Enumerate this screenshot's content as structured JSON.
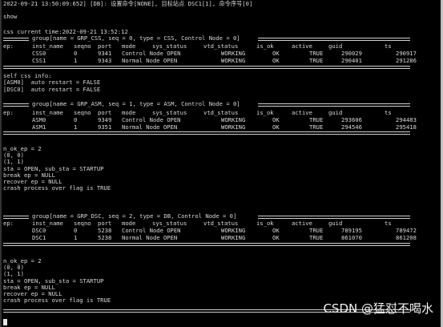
{
  "terminal": {
    "header": "2022-09-21 13:50:09:652] [DB]: 设置命令[NONE], 目标站点 DSC1[1], 命令序号[0]",
    "show": "show",
    "css_time": "css current time:2022-09-21 13:52:12",
    "group0_title": "group[name = GRP_CSS, seq = 0, type = CSS, Control Node = 0]",
    "group1_title": "group[name = GRP_ASM, seq = 1, type = ASM, Control Node = 0]",
    "group2_title": "group[name = GRP_DSC, seq = 2, type = DB, Control Node = 0]",
    "columns": [
      "ep:",
      "inst_name",
      "seqno",
      "port",
      "mode",
      "sys_status",
      "vtd_status",
      "is_ok",
      "active",
      "guid",
      "ts"
    ],
    "css_rows": [
      [
        "",
        "CSS0",
        "0",
        "9341",
        "Control Node",
        "OPEN",
        "WORKING",
        "OK",
        "TRUE",
        "290029",
        "290917"
      ],
      [
        "",
        "CSS1",
        "1",
        "9343",
        "Normal Node",
        "OPEN",
        "WORKING",
        "OK",
        "TRUE",
        "290401",
        "291286"
      ]
    ],
    "self_css_info": "self css info:",
    "asm_restart": "[ASM0]  auto restart = FALSE",
    "dsc_restart": "[DSC0]  auto restart = FALSE",
    "asm_rows": [
      [
        "",
        "ASM0",
        "0",
        "9349",
        "Control Node",
        "OPEN",
        "WORKING",
        "OK",
        "TRUE",
        "293606",
        "294483"
      ],
      [
        "",
        "ASM1",
        "1",
        "9351",
        "Normal Node",
        "OPEN",
        "WORKING",
        "OK",
        "TRUE",
        "294546",
        "295418"
      ]
    ],
    "dsc_rows": [
      [
        "",
        "DSC0",
        "0",
        "5238",
        "Control Node",
        "OPEN",
        "WORKING",
        "OK",
        "TRUE",
        "789195",
        "789472"
      ],
      [
        "",
        "DSC1",
        "1",
        "5238",
        "Normal Node",
        "OPEN",
        "WORKING",
        "OK",
        "TRUE",
        "861070",
        "861208"
      ]
    ],
    "ok_block_1": [
      "n_ok_ep = 2",
      "(0, 0)",
      "(1, 1)",
      "sta = OPEN, sub_sta = STARTUP",
      "break ep = NULL",
      "recover ep = NULL",
      "crash process over flag is TRUE"
    ],
    "ok_block_2": [
      "n_ok_ep = 2",
      "(0, 0)",
      "(1, 1)",
      "sta = OPEN, sub_sta = STARTUP",
      "break ep = NULL",
      "recover ep = NULL",
      "crash process over flag is TRUE"
    ]
  },
  "watermark": "CSDN @猛怼不喝水",
  "colors": {
    "background": "#000000",
    "text": "#d8d8d8",
    "separator": "#cfcfcf"
  }
}
